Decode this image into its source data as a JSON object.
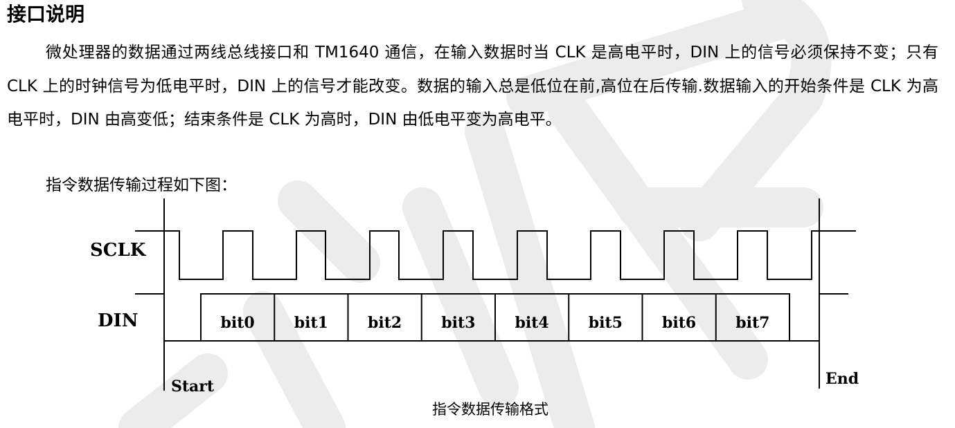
{
  "heading": "接口说明",
  "paragraph1": "微处理器的数据通过两线总线接口和 TM1640 通信，在输入数据时当 CLK 是高电平时，DIN 上的信号必须保持不变；只有 CLK 上的时钟信号为低电平时，DIN 上的信号才能改变。数据的输入总是低位在前,高位在后传输.数据输入的开始条件是 CLK 为高电平时，DIN 由高变低；结束条件是 CLK 为高时，DIN 由低电平变为高电平。",
  "paragraph2": "指令数据传输过程如下图：",
  "diagram": {
    "sclk_label": "SCLK",
    "din_label": "DIN",
    "start_label": "Start",
    "end_label": "End",
    "bits": [
      "bit0",
      "bit1",
      "bit2",
      "bit3",
      "bit4",
      "bit5",
      "bit6",
      "bit7"
    ]
  },
  "caption": "指令数据传输格式",
  "watermark_color": "#ebebeb"
}
